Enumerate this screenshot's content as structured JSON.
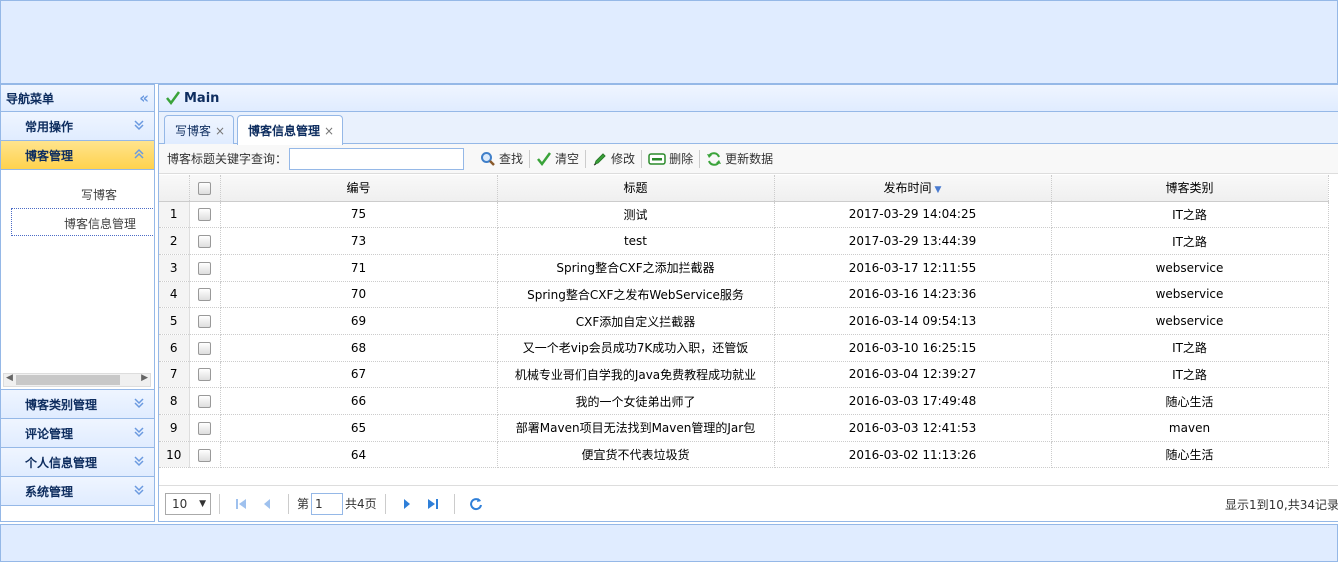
{
  "west": {
    "title": "导航菜单",
    "collapse_icon": "double-chevron-left-icon"
  },
  "accordion": [
    {
      "label": "常用操作",
      "state": "collapsed"
    },
    {
      "label": "博客管理",
      "state": "expanded",
      "items": [
        "写博客",
        "博客信息管理"
      ]
    },
    {
      "label": "博客类别管理",
      "state": "collapsed"
    },
    {
      "label": "评论管理",
      "state": "collapsed"
    },
    {
      "label": "个人信息管理",
      "state": "collapsed"
    },
    {
      "label": "系统管理",
      "state": "collapsed"
    }
  ],
  "center": {
    "title": "Main"
  },
  "tabs": [
    {
      "label": "写博客",
      "close": "×"
    },
    {
      "label": "博客信息管理",
      "close": "×",
      "active": true
    }
  ],
  "toolbar": {
    "search_label": "博客标题关键字查询：",
    "search_value": "",
    "buttons": {
      "find": "查找",
      "clear": "清空",
      "edit": "修改",
      "delete": "删除",
      "refresh": "更新数据"
    }
  },
  "grid": {
    "columns": [
      "编号",
      "标题",
      "发布时间",
      "博客类别"
    ],
    "sorted_column": "发布时间",
    "rows": [
      {
        "n": "1",
        "id": "75",
        "title": "测试",
        "time": "2017-03-29 14:04:25",
        "type": "IT之路"
      },
      {
        "n": "2",
        "id": "73",
        "title": "test",
        "time": "2017-03-29 13:44:39",
        "type": "IT之路"
      },
      {
        "n": "3",
        "id": "71",
        "title": "Spring整合CXF之添加拦截器",
        "time": "2016-03-17 12:11:55",
        "type": "webservice"
      },
      {
        "n": "4",
        "id": "70",
        "title": "Spring整合CXF之发布WebService服务",
        "time": "2016-03-16 14:23:36",
        "type": "webservice"
      },
      {
        "n": "5",
        "id": "69",
        "title": "CXF添加自定义拦截器",
        "time": "2016-03-14 09:54:13",
        "type": "webservice"
      },
      {
        "n": "6",
        "id": "68",
        "title": "又一个老vip会员成功7K成功入职，还管饭",
        "time": "2016-03-10 16:25:15",
        "type": "IT之路"
      },
      {
        "n": "7",
        "id": "67",
        "title": "机械专业哥们自学我的Java免费教程成功就业",
        "time": "2016-03-04 12:39:27",
        "type": "IT之路"
      },
      {
        "n": "8",
        "id": "66",
        "title": "我的一个女徒弟出师了",
        "time": "2016-03-03 17:49:48",
        "type": "随心生活"
      },
      {
        "n": "9",
        "id": "65",
        "title": "部署Maven项目无法找到Maven管理的Jar包",
        "time": "2016-03-03 12:41:53",
        "type": "maven"
      },
      {
        "n": "10",
        "id": "64",
        "title": "便宜货不代表垃圾货",
        "time": "2016-03-02 11:13:26",
        "type": "随心生活"
      }
    ]
  },
  "pager": {
    "page_size": "10",
    "page_prefix": "第",
    "page_value": "1",
    "page_suffix": "共4页",
    "info": "显示1到10,共34记录"
  },
  "colors": {
    "border": "#95b8e7",
    "header_bg": "#e0ecff",
    "selected_accordion": "#ffd24d"
  }
}
